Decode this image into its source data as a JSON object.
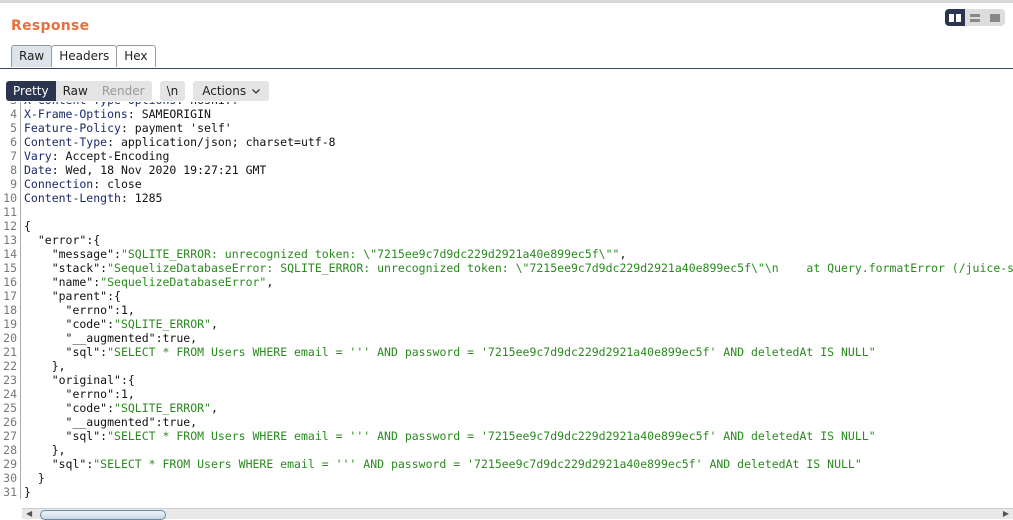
{
  "title": "Response",
  "view_tabs": [
    {
      "label": "Raw",
      "active": true
    },
    {
      "label": "Headers"
    },
    {
      "label": "Hex"
    }
  ],
  "toolbar": {
    "pretty": "Pretty",
    "raw": "Raw",
    "render": "Render",
    "newline": "\\n",
    "actions": "Actions"
  },
  "lines": [
    [
      [
        "h",
        "X-Content-Type-Options"
      ],
      [
        "v",
        ": nosniff"
      ]
    ],
    [
      [
        "h",
        "X-Frame-Options"
      ],
      [
        "v",
        ": SAMEORIGIN"
      ]
    ],
    [
      [
        "h",
        "Feature-Policy"
      ],
      [
        "v",
        ": payment 'self'"
      ]
    ],
    [
      [
        "h",
        "Content-Type"
      ],
      [
        "v",
        ": application/json; charset=utf-8"
      ]
    ],
    [
      [
        "h",
        "Vary"
      ],
      [
        "v",
        ": Accept-Encoding"
      ]
    ],
    [
      [
        "h",
        "Date"
      ],
      [
        "v",
        ": Wed, 18 Nov 2020 19:27:21 GMT"
      ]
    ],
    [
      [
        "h",
        "Connection"
      ],
      [
        "v",
        ": close"
      ]
    ],
    [
      [
        "h",
        "Content-Length"
      ],
      [
        "v",
        ": 1285"
      ]
    ],
    [],
    [
      [
        "p",
        "{"
      ]
    ],
    [
      [
        "k",
        "  \"error\""
      ],
      [
        "p",
        ":{"
      ]
    ],
    [
      [
        "k",
        "    \"message\""
      ],
      [
        "p",
        ":"
      ],
      [
        "s",
        "\"SQLITE_ERROR: unrecognized token: \\\"7215ee9c7d9dc229d2921a40e899ec5f\\\"\""
      ],
      [
        "p",
        ","
      ]
    ],
    [
      [
        "k",
        "    \"stack\""
      ],
      [
        "p",
        ":"
      ],
      [
        "s",
        "\"SequelizeDatabaseError: SQLITE_ERROR: unrecognized token: \\\"7215ee9c7d9dc229d2921a40e899ec5f\\\"\\n    at Query.formatError (/juice-shop/node_modules/sequelize/lib/dialects/sqlite/query.js"
      ]
    ],
    [
      [
        "k",
        "    \"name\""
      ],
      [
        "p",
        ":"
      ],
      [
        "s",
        "\"SequelizeDatabaseError\""
      ],
      [
        "p",
        ","
      ]
    ],
    [
      [
        "k",
        "    \"parent\""
      ],
      [
        "p",
        ":{"
      ]
    ],
    [
      [
        "k",
        "      \"errno\""
      ],
      [
        "p",
        ":1,"
      ]
    ],
    [
      [
        "k",
        "      \"code\""
      ],
      [
        "p",
        ":"
      ],
      [
        "s",
        "\"SQLITE_ERROR\""
      ],
      [
        "p",
        ","
      ]
    ],
    [
      [
        "k",
        "      \"__augmented\""
      ],
      [
        "p",
        ":true,"
      ]
    ],
    [
      [
        "k",
        "      \"sql\""
      ],
      [
        "p",
        ":"
      ],
      [
        "s",
        "\"SELECT * FROM Users WHERE email = ''' AND password = '7215ee9c7d9dc229d2921a40e899ec5f' AND deletedAt IS NULL\""
      ]
    ],
    [
      [
        "p",
        "    },"
      ]
    ],
    [
      [
        "k",
        "    \"original\""
      ],
      [
        "p",
        ":{"
      ]
    ],
    [
      [
        "k",
        "      \"errno\""
      ],
      [
        "p",
        ":1,"
      ]
    ],
    [
      [
        "k",
        "      \"code\""
      ],
      [
        "p",
        ":"
      ],
      [
        "s",
        "\"SQLITE_ERROR\""
      ],
      [
        "p",
        ","
      ]
    ],
    [
      [
        "k",
        "      \"__augmented\""
      ],
      [
        "p",
        ":true,"
      ]
    ],
    [
      [
        "k",
        "      \"sql\""
      ],
      [
        "p",
        ":"
      ],
      [
        "s",
        "\"SELECT * FROM Users WHERE email = ''' AND password = '7215ee9c7d9dc229d2921a40e899ec5f' AND deletedAt IS NULL\""
      ]
    ],
    [
      [
        "p",
        "    },"
      ]
    ],
    [
      [
        "k",
        "    \"sql\""
      ],
      [
        "p",
        ":"
      ],
      [
        "s",
        "\"SELECT * FROM Users WHERE email = ''' AND password = '7215ee9c7d9dc229d2921a40e899ec5f' AND deletedAt IS NULL\""
      ]
    ],
    [
      [
        "p",
        "  }"
      ]
    ],
    [
      [
        "p",
        "}"
      ]
    ]
  ],
  "first_line_number": 3
}
